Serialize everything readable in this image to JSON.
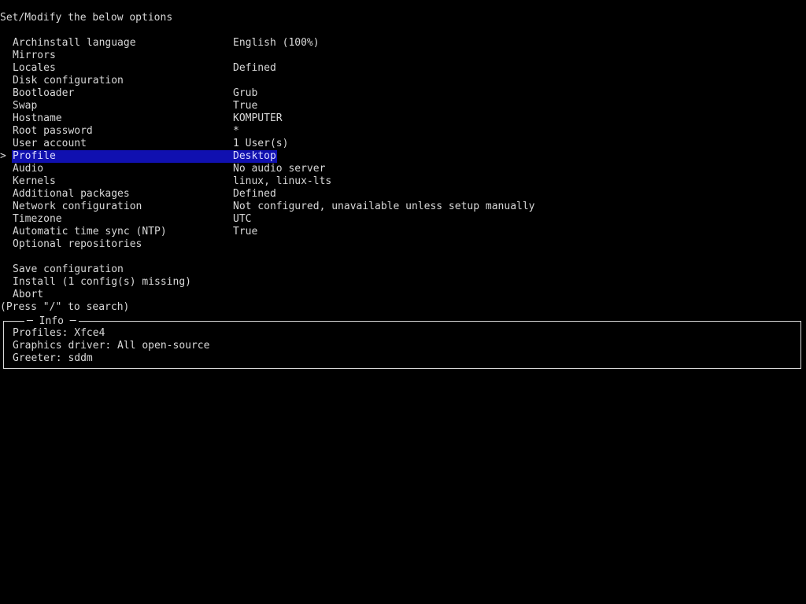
{
  "title": "Set/Modify the below options",
  "selector_glyph": ">",
  "menu": {
    "items": [
      {
        "label": "Archinstall language",
        "value": "English (100%)"
      },
      {
        "label": "Mirrors",
        "value": ""
      },
      {
        "label": "Locales",
        "value": "Defined"
      },
      {
        "label": "Disk configuration",
        "value": ""
      },
      {
        "label": "Bootloader",
        "value": "Grub"
      },
      {
        "label": "Swap",
        "value": "True"
      },
      {
        "label": "Hostname",
        "value": "KOMPUTER"
      },
      {
        "label": "Root password",
        "value": "*"
      },
      {
        "label": "User account",
        "value": "1 User(s)"
      },
      {
        "label": "Profile",
        "value": "Desktop",
        "selected": true
      },
      {
        "label": "Audio",
        "value": "No audio server"
      },
      {
        "label": "Kernels",
        "value": "linux, linux-lts"
      },
      {
        "label": "Additional packages",
        "value": "Defined"
      },
      {
        "label": "Network configuration",
        "value": "Not configured, unavailable unless setup manually"
      },
      {
        "label": "Timezone",
        "value": "UTC"
      },
      {
        "label": "Automatic time sync (NTP)",
        "value": "True"
      },
      {
        "label": "Optional repositories",
        "value": ""
      }
    ],
    "actions": [
      {
        "label": "Save configuration"
      },
      {
        "label": "Install (1 config(s) missing)"
      },
      {
        "label": "Abort"
      }
    ]
  },
  "search_hint": "(Press \"/\" to search)",
  "info": {
    "title": "Info",
    "lines": [
      "Profiles: Xfce4",
      "Graphics driver: All open-source",
      "Greeter: sddm"
    ]
  },
  "colors": {
    "background": "#000000",
    "text": "#d8d8d8",
    "selection_bg": "#1010b0"
  }
}
